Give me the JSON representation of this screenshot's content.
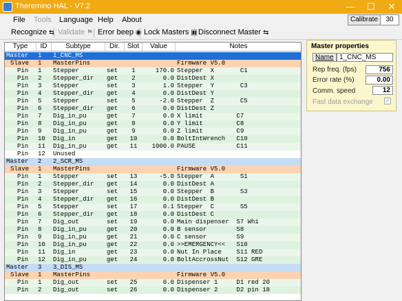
{
  "window": {
    "title": "Theremino HAL - V7.2",
    "minimize": "—",
    "maximize": "☐",
    "close": "✕"
  },
  "menu": [
    {
      "label": "File",
      "disabled": false
    },
    {
      "label": "Tools",
      "disabled": true
    },
    {
      "label": "Language",
      "disabled": false
    },
    {
      "label": "Help",
      "disabled": false
    },
    {
      "label": "About",
      "disabled": false
    }
  ],
  "calibrate": {
    "label": "Calibrate",
    "value": "30"
  },
  "toolbar": {
    "recognize": "Recognize",
    "validate": "Validate",
    "error_beep": "Error beep",
    "lock_masters": "Lock Masters",
    "disconnect_master": "Disconnect Master"
  },
  "grid": {
    "columns": [
      "Type",
      "ID",
      "Subtype",
      "Dir.",
      "Slot",
      "Value",
      "Notes"
    ],
    "rows": [
      {
        "kind": "master",
        "sel": true,
        "c": [
          "Master",
          "1",
          "1_CNC_MS",
          "",
          "",
          "",
          ""
        ]
      },
      {
        "kind": "slave",
        "c": [
          "Slave",
          "1",
          "MasterPins",
          "",
          "",
          "",
          "Firmware V5.0"
        ]
      },
      {
        "kind": "pin",
        "c": [
          "Pin",
          "1",
          "Stepper",
          "set",
          "1",
          "170.0",
          "Stepper  X       C1"
        ]
      },
      {
        "kind": "pin",
        "c": [
          "Pin",
          "2",
          "Stepper_dir",
          "get",
          "2",
          "0.0",
          "DistDest X"
        ]
      },
      {
        "kind": "pin",
        "c": [
          "Pin",
          "3",
          "Stepper",
          "set",
          "3",
          "1.0",
          "Stepper  Y       C3"
        ]
      },
      {
        "kind": "pin",
        "c": [
          "Pin",
          "4",
          "Stepper_dir",
          "get",
          "4",
          "0.0",
          "DistDest Y"
        ]
      },
      {
        "kind": "pin",
        "c": [
          "Pin",
          "5",
          "Stepper",
          "set",
          "5",
          "-2.0",
          "Stepper  Z       C5"
        ]
      },
      {
        "kind": "pin",
        "c": [
          "Pin",
          "6",
          "Stepper_dir",
          "get",
          "6",
          "0.0",
          "DistDest Z"
        ]
      },
      {
        "kind": "pin",
        "c": [
          "Pin",
          "7",
          "Dig_in_pu",
          "get",
          "7",
          "0.0",
          "X limit         C7"
        ]
      },
      {
        "kind": "pin",
        "c": [
          "Pin",
          "8",
          "Dig_in_pu",
          "get",
          "8",
          "0.0",
          "Y limit         C8"
        ]
      },
      {
        "kind": "pin",
        "c": [
          "Pin",
          "9",
          "Dig_in_pu",
          "get",
          "9",
          "0.0",
          "Z limit         C9"
        ]
      },
      {
        "kind": "pin",
        "c": [
          "Pin",
          "10",
          "Dig_in",
          "get",
          "10",
          "0.0",
          "BoltIntWrench   C10"
        ]
      },
      {
        "kind": "pin",
        "c": [
          "Pin",
          "11",
          "Dig_in_pu",
          "get",
          "11",
          "1000.0",
          "PAUSE           C11"
        ]
      },
      {
        "kind": "unused",
        "c": [
          "Pin",
          "12",
          "Unused",
          "",
          "",
          "",
          ""
        ]
      },
      {
        "kind": "master",
        "c": [
          "Master",
          "2",
          "2_SCR_MS",
          "",
          "",
          "",
          ""
        ]
      },
      {
        "kind": "slave",
        "c": [
          "Slave",
          "1",
          "MasterPins",
          "",
          "",
          "",
          "Firmware V5.0"
        ]
      },
      {
        "kind": "pin",
        "c": [
          "Pin",
          "1",
          "Stepper",
          "set",
          "13",
          "-5.0",
          "Stepper  A       S1"
        ]
      },
      {
        "kind": "pin",
        "c": [
          "Pin",
          "2",
          "Stepper_dir",
          "get",
          "14",
          "0.0",
          "DistDest A"
        ]
      },
      {
        "kind": "pin",
        "c": [
          "Pin",
          "3",
          "Stepper",
          "set",
          "15",
          "0.0",
          "Stepper  B       S3"
        ]
      },
      {
        "kind": "pin",
        "c": [
          "Pin",
          "4",
          "Stepper_dir",
          "get",
          "16",
          "0.0",
          "DistDest B"
        ]
      },
      {
        "kind": "pin",
        "c": [
          "Pin",
          "5",
          "Stepper",
          "set",
          "17",
          "0.1",
          "Stepper  C       S5"
        ]
      },
      {
        "kind": "pin",
        "c": [
          "Pin",
          "6",
          "Stepper_dir",
          "get",
          "18",
          "0.0",
          "DistDest C"
        ]
      },
      {
        "kind": "pin",
        "c": [
          "Pin",
          "7",
          "Dig_out",
          "set",
          "19",
          "0.0",
          "Main dispenser  S7 Whi"
        ]
      },
      {
        "kind": "pin",
        "c": [
          "Pin",
          "8",
          "Dig_in_pu",
          "get",
          "20",
          "0.0",
          "B sensor        S8"
        ]
      },
      {
        "kind": "pin",
        "c": [
          "Pin",
          "9",
          "Dig_in_pu",
          "get",
          "21",
          "0.0",
          "C sensor        S9"
        ]
      },
      {
        "kind": "pin",
        "c": [
          "Pin",
          "10",
          "Dig_in_pu",
          "get",
          "22",
          "0.0",
          ">>EMERGENCY<<   S10"
        ]
      },
      {
        "kind": "pin",
        "c": [
          "Pin",
          "11",
          "Dig_in",
          "get",
          "23",
          "0.0",
          "Nut In Place    S11 RED"
        ]
      },
      {
        "kind": "pin",
        "c": [
          "Pin",
          "12",
          "Dig_in_pu",
          "get",
          "24",
          "0.0",
          "BoltAccrossNut  S12 GRE"
        ]
      },
      {
        "kind": "master",
        "c": [
          "Master",
          "3",
          "3_DIS_MS",
          "",
          "",
          "",
          ""
        ]
      },
      {
        "kind": "slave",
        "c": [
          "Slave",
          "1",
          "MasterPins",
          "",
          "",
          "",
          "Firmware V5.0"
        ]
      },
      {
        "kind": "pin",
        "c": [
          "Pin",
          "1",
          "Dig_out",
          "set",
          "25",
          "0.0",
          "Dispenser 1     D1 red 20"
        ]
      },
      {
        "kind": "pin",
        "c": [
          "Pin",
          "2",
          "Dig_out",
          "set",
          "26",
          "0.0",
          "Dispenser 2     D2 pin 18"
        ]
      }
    ]
  },
  "panel": {
    "title": "Master properties",
    "name_button": "Name",
    "name_value": "1_CNC_MS",
    "rep_freq_label": "Rep freq. (fps)",
    "rep_freq_value": "756",
    "error_rate_label": "Error rate (%)",
    "error_rate_value": "0.00",
    "comm_speed_label": "Comm. speed",
    "comm_speed_value": "12",
    "fast_exchange_label": "Fast data exchange",
    "fast_exchange_checked": "✓"
  }
}
